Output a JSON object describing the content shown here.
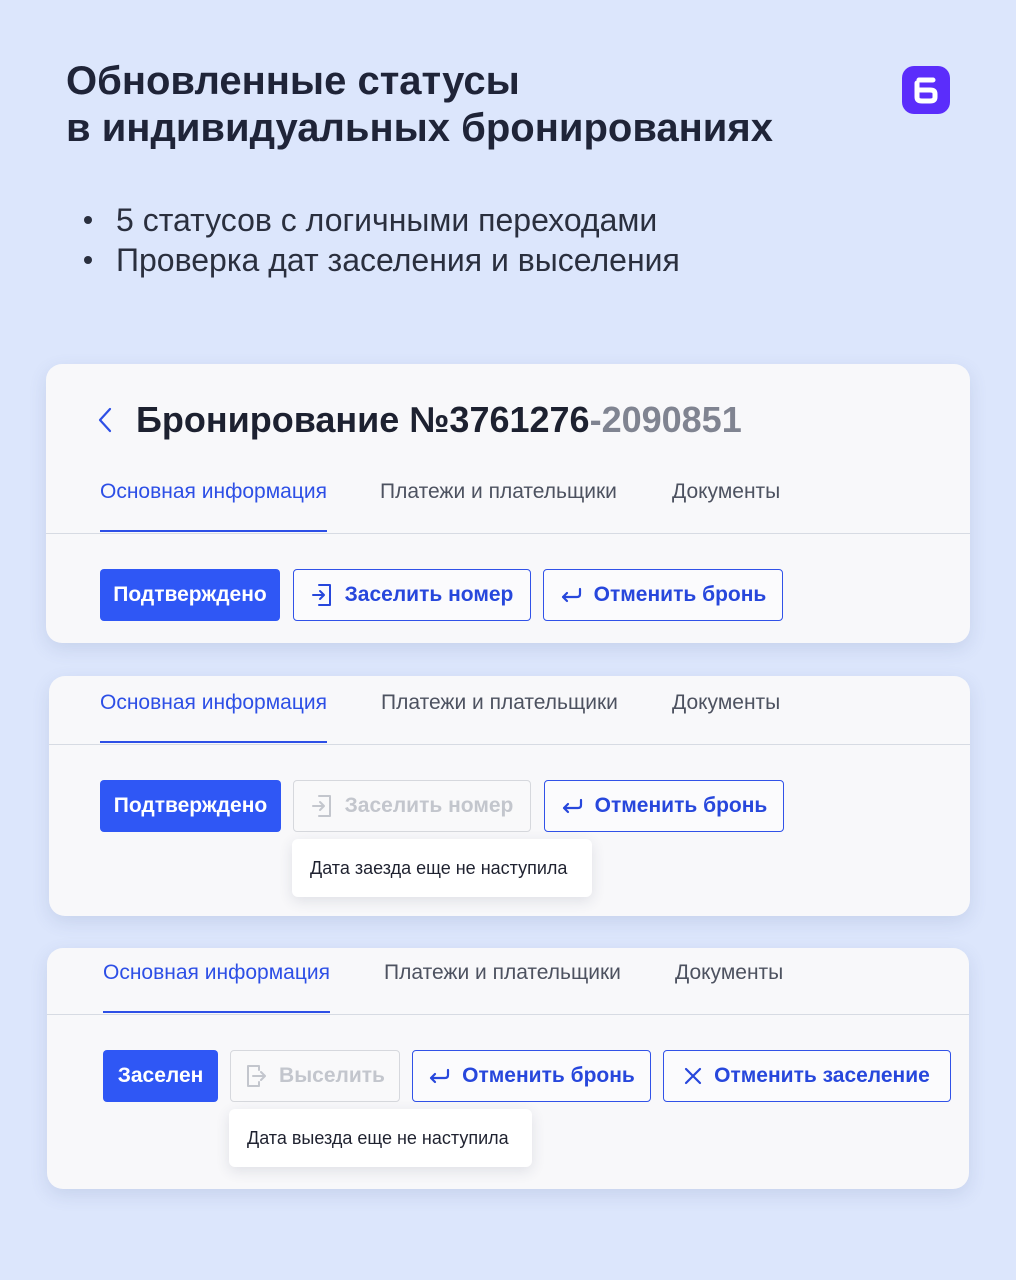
{
  "header": {
    "title_line1": "Обновленные статусы",
    "title_line2": "в индивидуальных бронированиях",
    "brand_color": "#5b2dfb"
  },
  "bullets": [
    "5 статусов с логичными переходами",
    "Проверка дат заселения и выселения"
  ],
  "colors": {
    "accent": "#2f57f5",
    "background": "#dce6fc",
    "disabled": "#c3c6cd"
  },
  "booking": {
    "title_prefix": "Бронирование №3761276",
    "title_suffix": "-2090851"
  },
  "tabs": {
    "main": "Основная информация",
    "payments": "Платежи и плательщики",
    "documents": "Документы"
  },
  "card1": {
    "status_label": "Подтверждено",
    "checkin_label": "Заселить номер",
    "cancel_label": "Отменить бронь"
  },
  "card2": {
    "status_label": "Подтверждено",
    "checkin_label": "Заселить номер",
    "cancel_label": "Отменить бронь",
    "tooltip": "Дата заезда еще не наступила"
  },
  "card3": {
    "status_label": "Заселен",
    "checkout_label": "Выселить",
    "cancel_label": "Отменить бронь",
    "cancel_checkin_label": "Отменить заселение",
    "tooltip": "Дата выезда еще не наступила"
  },
  "icons": {
    "logo": "brand-logo-icon",
    "back": "chevron-left-icon",
    "checkin": "door-enter-icon",
    "checkout": "door-exit-icon",
    "undo": "return-arrow-icon",
    "close": "close-x-icon"
  }
}
